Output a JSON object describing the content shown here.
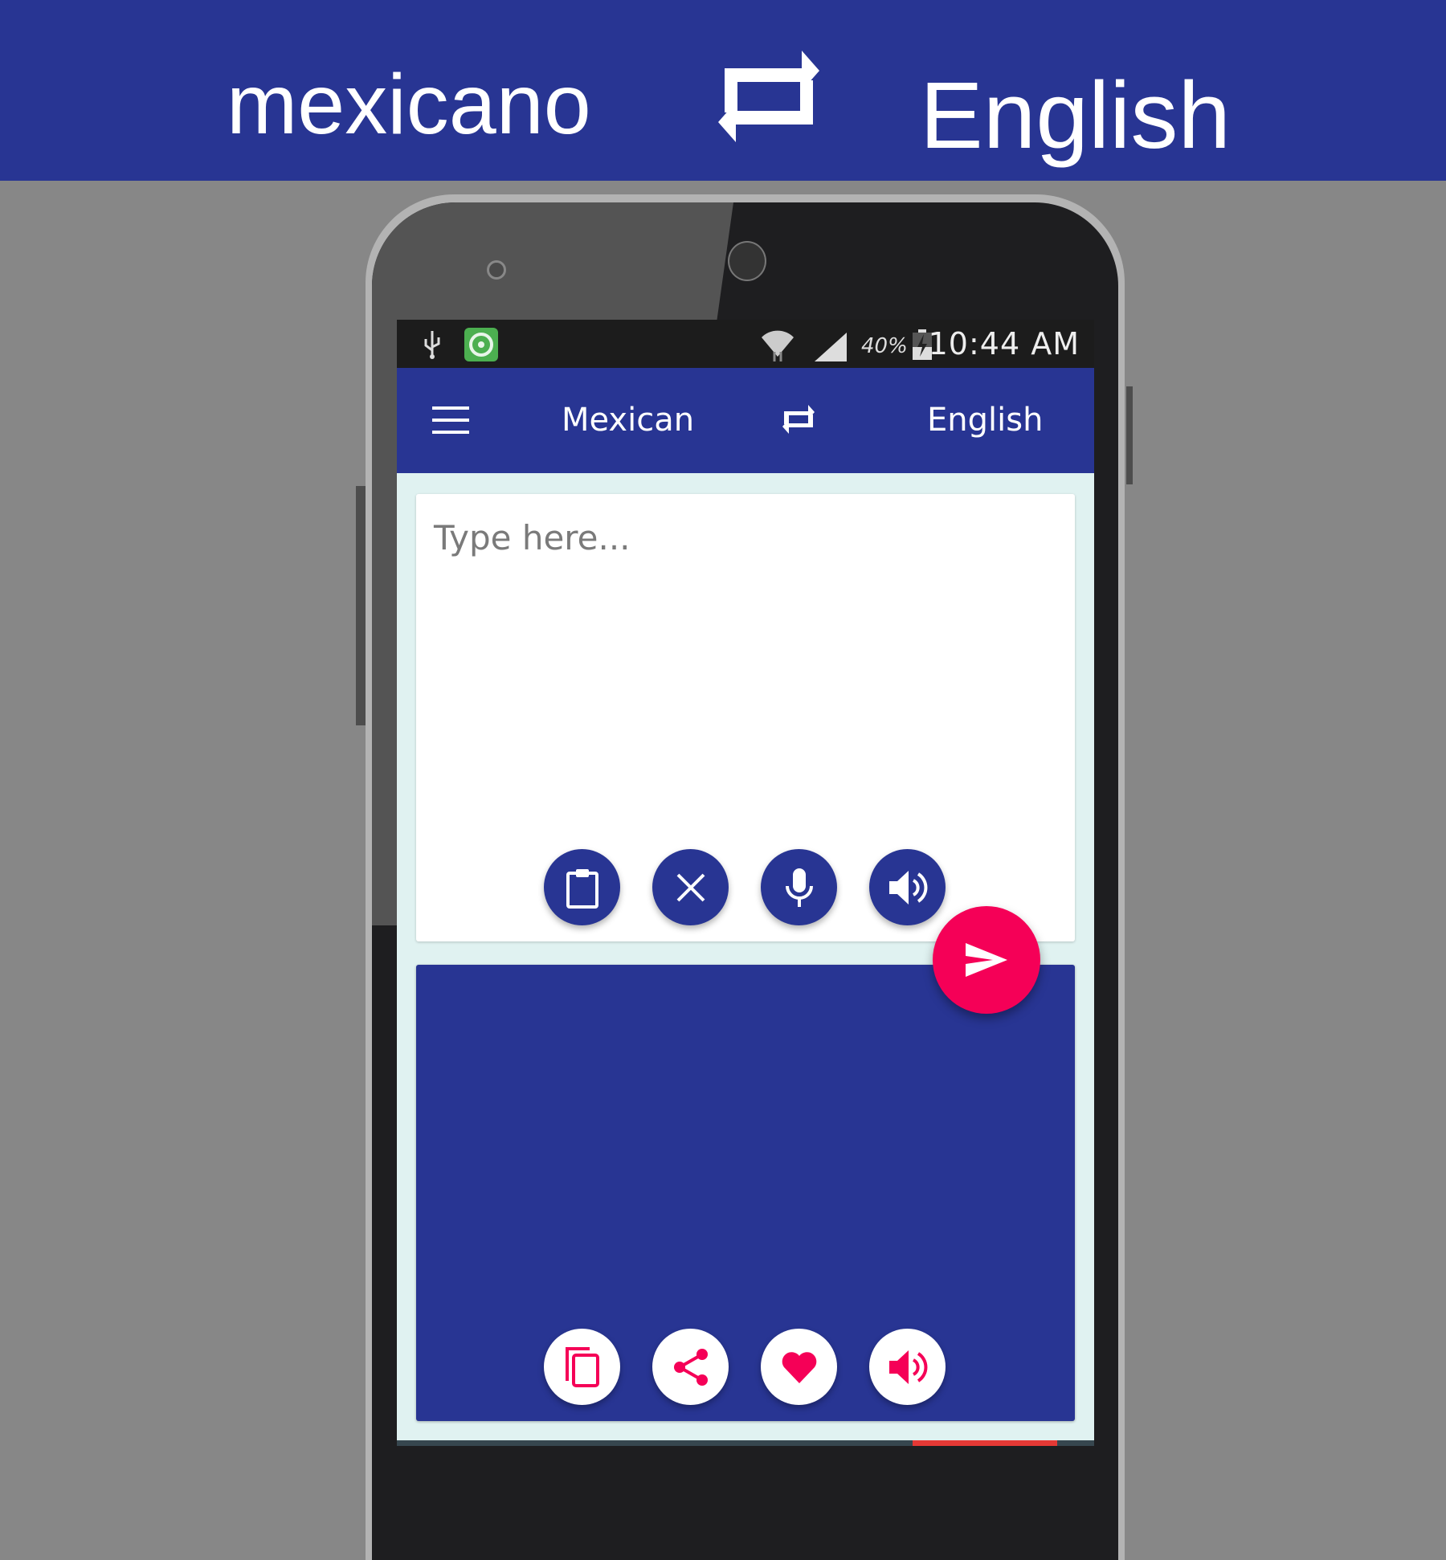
{
  "banner": {
    "source_language": "mexicano",
    "target_language": "English",
    "swap_icon": "swap-arrows-icon"
  },
  "statusbar": {
    "left_icons": [
      "usb-icon",
      "app-notification-icon"
    ],
    "right_icons": [
      "wifi-icon",
      "cellular-signal-icon",
      "battery-charging-icon"
    ],
    "battery_percent": "40%",
    "time": "10:44 AM"
  },
  "appbar": {
    "menu_icon": "hamburger-menu-icon",
    "source_language": "Mexican",
    "swap_icon": "swap-arrows-icon",
    "target_language": "English"
  },
  "input": {
    "placeholder": "Type here...",
    "value": "",
    "actions": [
      {
        "name": "paste",
        "icon": "clipboard-icon"
      },
      {
        "name": "clear",
        "icon": "close-icon"
      },
      {
        "name": "voice-input",
        "icon": "microphone-icon"
      },
      {
        "name": "speak-input",
        "icon": "speaker-icon"
      }
    ]
  },
  "translate_button": {
    "icon": "send-icon"
  },
  "output": {
    "value": "",
    "actions": [
      {
        "name": "copy",
        "icon": "copy-icon"
      },
      {
        "name": "share",
        "icon": "share-icon"
      },
      {
        "name": "favorite",
        "icon": "heart-icon"
      },
      {
        "name": "speak-output",
        "icon": "speaker-icon"
      }
    ]
  },
  "colors": {
    "primary": "#283593",
    "accent": "#f50057",
    "background": "#e0f2f1"
  }
}
